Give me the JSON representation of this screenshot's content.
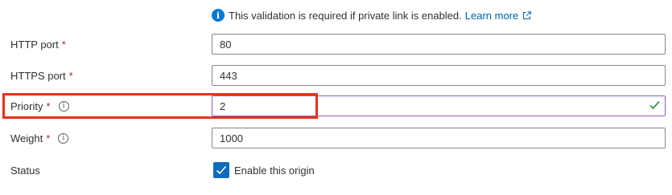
{
  "info": {
    "message": "This validation is required if private link is enabled.",
    "link_label": "Learn more"
  },
  "fields": {
    "http_port": {
      "label": "HTTP port",
      "required_mark": "*",
      "value": "80"
    },
    "https_port": {
      "label": "HTTPS port",
      "required_mark": "*",
      "value": "443"
    },
    "priority": {
      "label": "Priority",
      "required_mark": "*",
      "value": "2",
      "valid": true
    },
    "weight": {
      "label": "Weight",
      "required_mark": "*",
      "value": "1000"
    }
  },
  "status": {
    "label": "Status",
    "checkbox_label": "Enable this origin",
    "checked": true
  },
  "icons": {
    "info": "info-circle-icon",
    "external": "external-link-icon",
    "tooltip": "info-tooltip-icon",
    "check": "checkmark-icon"
  },
  "colors": {
    "accent": "#0078d4",
    "link": "#0062ad",
    "required": "#a4262c",
    "valid_check": "#107c10",
    "highlight": "#e8311a"
  }
}
